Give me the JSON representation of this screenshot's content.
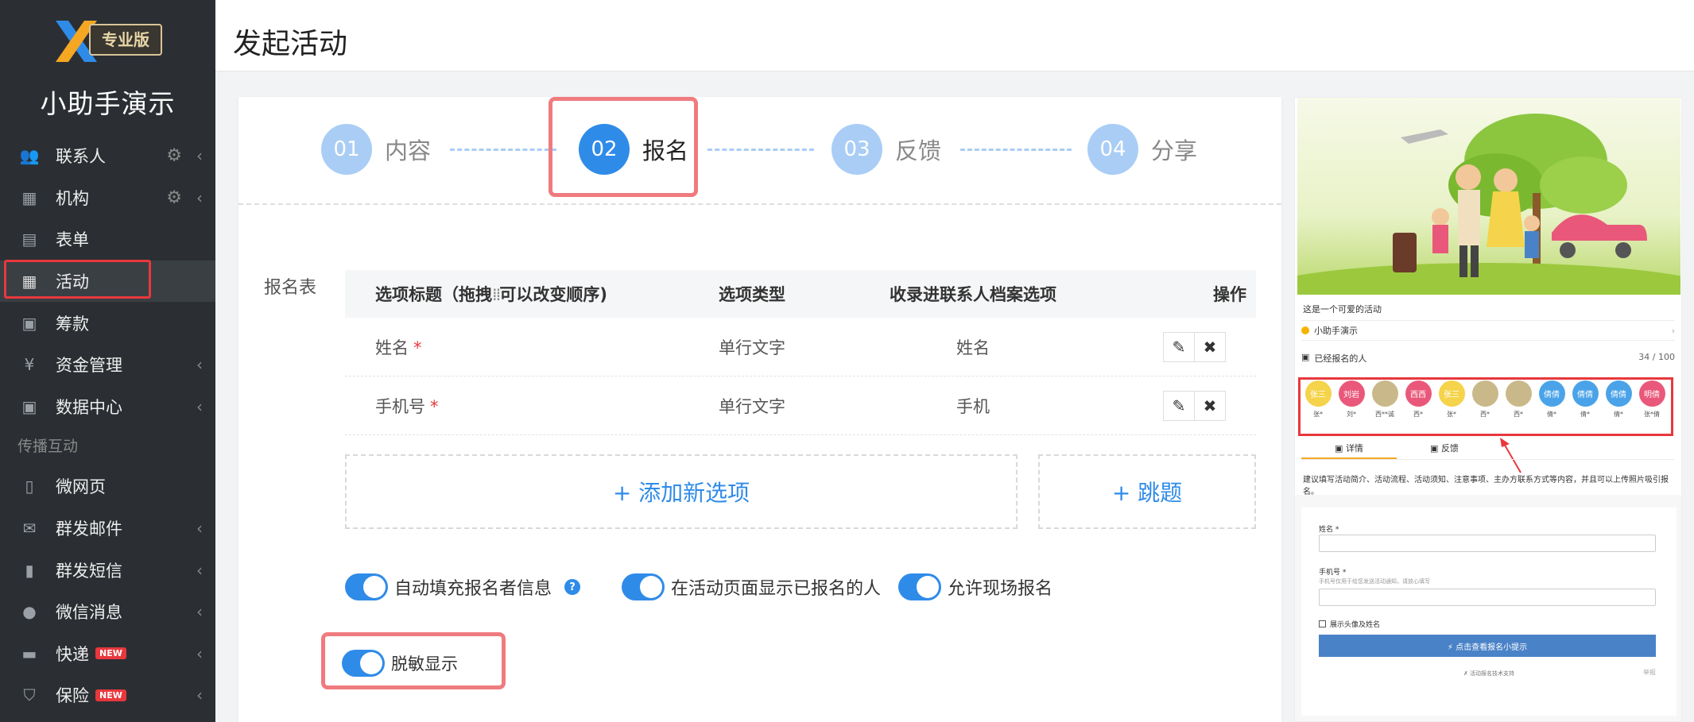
{
  "sidebar": {
    "logo_badge": "专业版",
    "brand": "小助手演示",
    "items": [
      {
        "label": "联系人",
        "icon": "contacts-icon",
        "glyph": "👥",
        "gear": true,
        "chevron": true
      },
      {
        "label": "机构",
        "icon": "building-icon",
        "glyph": "▦",
        "gear": true,
        "chevron": true
      },
      {
        "label": "表单",
        "icon": "clipboard-icon",
        "glyph": "▤",
        "gear": false,
        "chevron": false
      },
      {
        "label": "活动",
        "icon": "calendar-icon",
        "glyph": "▦",
        "gear": false,
        "chevron": false,
        "active": true
      },
      {
        "label": "筹款",
        "icon": "cash-icon",
        "glyph": "▣",
        "gear": false,
        "chevron": false
      },
      {
        "label": "资金管理",
        "icon": "yen-icon",
        "glyph": "¥",
        "gear": false,
        "chevron": true
      },
      {
        "label": "数据中心",
        "icon": "data-icon",
        "glyph": "▣",
        "gear": false,
        "chevron": true
      }
    ],
    "section_label": "传播互动",
    "items2": [
      {
        "label": "微网页",
        "icon": "file-icon",
        "glyph": "▯",
        "chevron": false,
        "new": false
      },
      {
        "label": "群发邮件",
        "icon": "mail-icon",
        "glyph": "✉",
        "chevron": true,
        "new": false
      },
      {
        "label": "群发短信",
        "icon": "phone-icon",
        "glyph": "▮",
        "chevron": true,
        "new": false
      },
      {
        "label": "微信消息",
        "icon": "wechat-icon",
        "glyph": "●",
        "chevron": true,
        "new": false
      },
      {
        "label": "快递",
        "icon": "truck-icon",
        "glyph": "▬",
        "chevron": true,
        "new": true
      },
      {
        "label": "保险",
        "icon": "shield-icon",
        "glyph": "⛉",
        "chevron": true,
        "new": true
      }
    ],
    "new_badge": "NEW"
  },
  "header": {
    "title": "发起活动"
  },
  "steps": [
    {
      "num": "01",
      "label": "内容"
    },
    {
      "num": "02",
      "label": "报名",
      "current": true
    },
    {
      "num": "03",
      "label": "反馈"
    },
    {
      "num": "04",
      "label": "分享"
    }
  ],
  "form": {
    "label": "报名表",
    "columns": {
      "title_a": "选项标题（拖拽",
      "title_b": "可以改变顺序)",
      "type": "选项类型",
      "mapping": "收录进联系人档案选项",
      "actions": "操作"
    },
    "rows": [
      {
        "title": "姓名",
        "required": "*",
        "type": "单行文字",
        "mapping": "姓名"
      },
      {
        "title": "手机号",
        "required": "*",
        "type": "单行文字",
        "mapping": "手机"
      }
    ],
    "add_option": "+ 添加新选项",
    "jump": "+ 跳题",
    "toggles": [
      {
        "label": "自动填充报名者信息",
        "help": "?"
      },
      {
        "label": "在活动页面显示已报名的人"
      },
      {
        "label": "允许现场报名"
      }
    ],
    "desensitize": "脱敏显示"
  },
  "preview": {
    "activity_title": "这是一个可爱的活动",
    "org": "小助手演示",
    "registered_label": "已经报名的人",
    "registered_count": "34 / 100",
    "avatars": [
      {
        "text": "张三",
        "name": "张*",
        "color": "#f5d34a"
      },
      {
        "text": "刘岩",
        "name": "刘*",
        "color": "#e9587a"
      },
      {
        "text": "",
        "name": "西**诚",
        "color": "#c9b98a"
      },
      {
        "text": "西西",
        "name": "西*",
        "color": "#e9587a"
      },
      {
        "text": "张三",
        "name": "张*",
        "color": "#f5d34a"
      },
      {
        "text": "",
        "name": "西*",
        "color": "#c9b98a"
      },
      {
        "text": "",
        "name": "西*",
        "color": "#c9b98a"
      },
      {
        "text": "倩倩",
        "name": "倩*",
        "color": "#4aa3e8"
      },
      {
        "text": "倩倩",
        "name": "倩*",
        "color": "#4aa3e8"
      },
      {
        "text": "倩倩",
        "name": "倩*",
        "color": "#4aa3e8"
      },
      {
        "text": "明倩",
        "name": "张*倩",
        "color": "#e9587a"
      }
    ],
    "tab_detail": "详情",
    "tab_feedback": "反馈",
    "description": "建议填写活动简介、活动流程、活动须知、注意事项、主办方联系方式等内容，并且可以上传照片吸引报名。",
    "field_name": "姓名 *",
    "field_phone": "手机号 *",
    "phone_hint": "手机号仅用于给您发送活动通知，请放心填写",
    "show_avatar": "展示头像及姓名",
    "submit": "⚡ 点击查看报名小提示",
    "footer": "✗ 活动报名技术支持",
    "footer_right": "举报"
  }
}
